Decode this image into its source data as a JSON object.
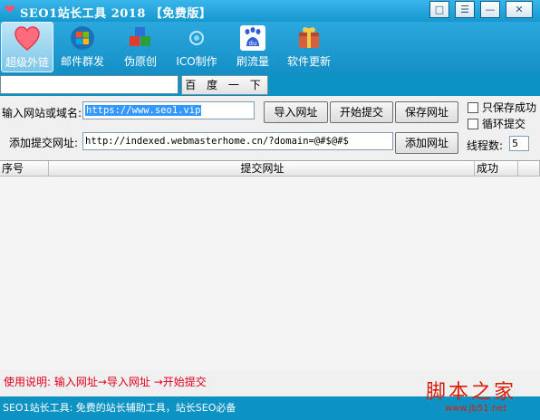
{
  "window": {
    "title": "SEO1站长工具 2018  【免费版】",
    "buttons": [
      "chat-icon",
      "menu-icon",
      "minimize-icon",
      "close-icon"
    ]
  },
  "toolbar": {
    "items": [
      {
        "label": "超级外链",
        "icon": "heart-icon",
        "active": true
      },
      {
        "label": "邮件群发",
        "icon": "windows-logo-icon",
        "active": false
      },
      {
        "label": "伪原创",
        "icon": "cubes-icon",
        "active": false
      },
      {
        "label": "ICO制作",
        "icon": "ico-icon",
        "active": false
      },
      {
        "label": "刷流量",
        "icon": "baidu-paw-icon",
        "active": false
      },
      {
        "label": "软件更新",
        "icon": "package-icon",
        "active": false
      }
    ]
  },
  "search": {
    "value": "",
    "button_label": "百 度 一 下"
  },
  "form": {
    "site_label": "输入网站或域名:",
    "site_value": "https://www.seo1.vip",
    "submit_label": "添加提交网址:",
    "submit_value": "http://indexed.webmasterhome.cn/?domain=@#$@#$",
    "import_button": "导入网址",
    "start_button": "开始提交",
    "save_button": "保存网址",
    "add_button": "添加网址",
    "only_success_label": "只保存成功",
    "loop_label": "循环提交",
    "threads_label": "线程数:",
    "threads_value": "5"
  },
  "table": {
    "columns": [
      "序号",
      "提交网址",
      "成功"
    ],
    "rows": []
  },
  "usage_text": "使用说明: 输入网址→导入网址 →开始提交",
  "status_text": "SEO1站长工具: 免费的站长辅助工具，站长SEO必备",
  "watermark": {
    "title": "脚本之家",
    "url": "www.jb51.net"
  },
  "colors": {
    "titlebar": "#1f9fd6",
    "panel": "#f0f0f0",
    "usage_red": "#e0001b"
  }
}
